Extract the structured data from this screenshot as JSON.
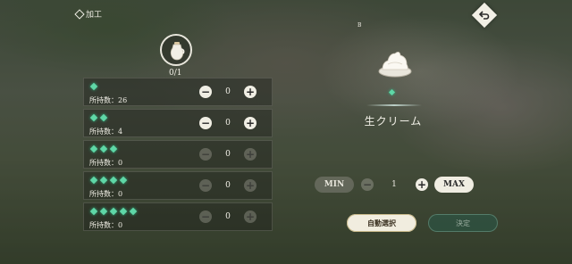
{
  "header": {
    "title": "加工"
  },
  "material": {
    "count": "0/1"
  },
  "rows": [
    {
      "stars": 1,
      "owned": "所持数：26",
      "value": "0",
      "minus_enabled": true,
      "plus_enabled": true
    },
    {
      "stars": 2,
      "owned": "所持数：4",
      "value": "0",
      "minus_enabled": true,
      "plus_enabled": true
    },
    {
      "stars": 3,
      "owned": "所持数：0",
      "value": "0",
      "minus_enabled": false,
      "plus_enabled": false
    },
    {
      "stars": 4,
      "owned": "所持数：0",
      "value": "0",
      "minus_enabled": false,
      "plus_enabled": false
    },
    {
      "stars": 5,
      "owned": "所持数：0",
      "value": "0",
      "minus_enabled": false,
      "plus_enabled": false
    }
  ],
  "product": {
    "tier": "B",
    "name": "生クリーム",
    "stars": 1
  },
  "quantity": {
    "min_label": "MIN",
    "max_label": "MAX",
    "value": "1"
  },
  "buttons": {
    "auto_select": "自動選択",
    "confirm": "決定"
  },
  "stepper": {
    "minus": "−",
    "plus": "+"
  },
  "colors": {
    "star": "#5fd7a7",
    "accent": "#f0ede2"
  }
}
